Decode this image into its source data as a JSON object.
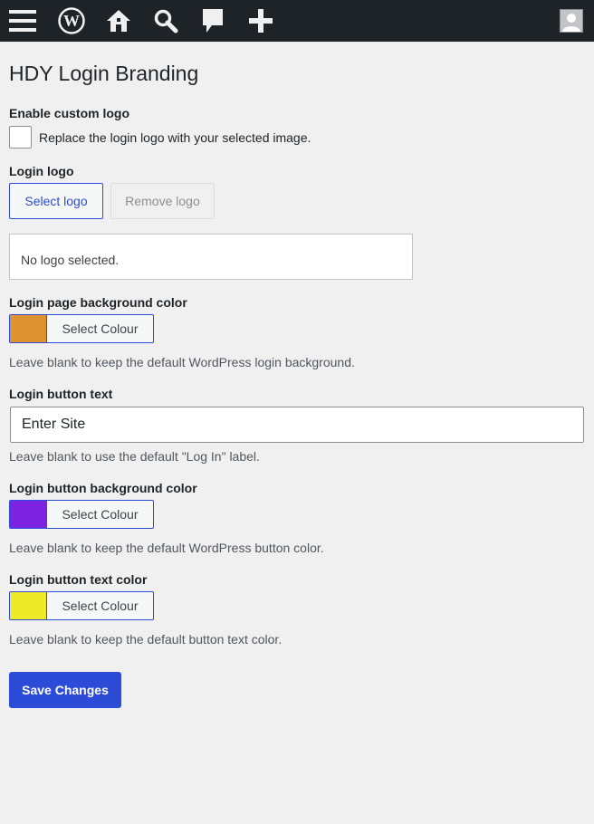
{
  "adminbar": {
    "items": [
      {
        "icon": "menu-icon"
      },
      {
        "icon": "wordpress-logo-icon"
      },
      {
        "icon": "home-icon"
      },
      {
        "icon": "search-icon"
      },
      {
        "icon": "comment-icon"
      },
      {
        "icon": "add-new-icon"
      }
    ],
    "avatar_icon": "user-avatar-icon"
  },
  "page": {
    "title": "HDY Login Branding"
  },
  "fields": {
    "custom_logo": {
      "label": "Enable custom logo",
      "checkbox_label": "Replace the login logo with your selected image.",
      "checked": false
    },
    "login_logo": {
      "label": "Login logo",
      "select_label": "Select logo",
      "remove_label": "Remove logo",
      "preview_text": "No logo selected."
    },
    "bg_color": {
      "label": "Login page background color",
      "swatch_color": "#dd9430",
      "picker_label": "Select Colour",
      "description": "Leave blank to keep the default WordPress login background."
    },
    "button_text": {
      "label": "Login button text",
      "value": "Enter Site",
      "description": "Leave blank to use the default \"Log In\" label."
    },
    "button_bg_color": {
      "label": "Login button background color",
      "swatch_color": "#7c22e0",
      "picker_label": "Select Colour",
      "description": "Leave blank to keep the default WordPress button color."
    },
    "button_text_color": {
      "label": "Login button text color",
      "swatch_color": "#eeea2a",
      "picker_label": "Select Colour",
      "description": "Leave blank to keep the default button text color."
    }
  },
  "actions": {
    "save_label": "Save Changes"
  },
  "colors": {
    "accent": "#2c4bd7",
    "adminbar_bg": "#1d2327",
    "page_bg": "#f0f0f1"
  }
}
